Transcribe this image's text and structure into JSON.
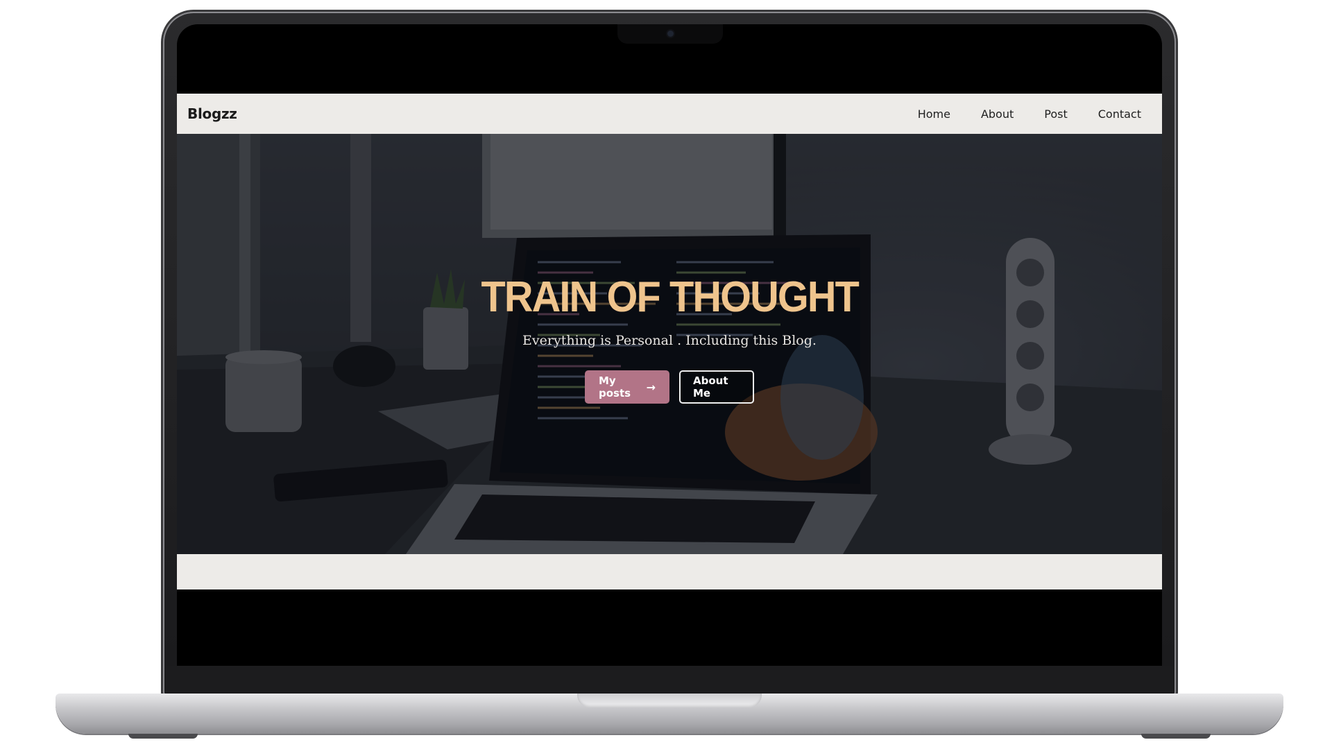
{
  "navbar": {
    "brand": "Blogzz",
    "links": [
      "Home",
      "About",
      "Post",
      "Contact"
    ]
  },
  "hero": {
    "title": "TRAIN OF THOUGHT",
    "subtitle": "Everything is Personal . Including this Blog.",
    "primary_button": "My posts",
    "primary_button_icon": "arrow-right-icon",
    "secondary_button": "About Me"
  },
  "colors": {
    "title": "#efc48d",
    "primary_button": "#b27487",
    "navbar_bg": "#edebe8"
  }
}
